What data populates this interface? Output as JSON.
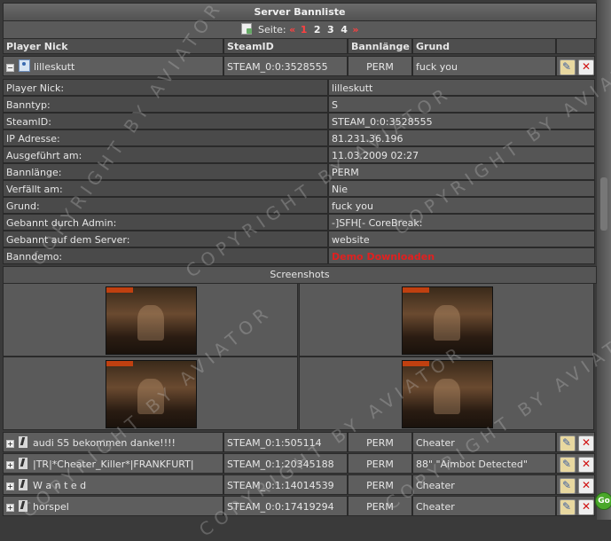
{
  "title": "Server Bannliste",
  "pager": {
    "label": "Seite:",
    "prev": "«",
    "pages": [
      "1",
      "2",
      "3",
      "4"
    ],
    "current": "1",
    "next": "»"
  },
  "columns": {
    "nick": "Player Nick",
    "steam": "SteamID",
    "length": "Bannlänge",
    "reason": "Grund"
  },
  "expanded_row": {
    "toggle": "−",
    "nick": "lilleskutt",
    "steam": "STEAM_0:0:3528555",
    "length": "PERM",
    "reason": "fuck you"
  },
  "details": [
    {
      "label": "Player Nick:",
      "value": "lilleskutt"
    },
    {
      "label": "Banntyp:",
      "value": "S"
    },
    {
      "label": "SteamID:",
      "value": "STEAM_0:0:3528555"
    },
    {
      "label": "IP Adresse:",
      "value": "81.231.36.196"
    },
    {
      "label": "Ausgeführt am:",
      "value": "11.03.2009 02:27"
    },
    {
      "label": "Bannlänge:",
      "value": "PERM"
    },
    {
      "label": "Verfällt am:",
      "value": "Nie"
    },
    {
      "label": "Grund:",
      "value": "fuck you"
    },
    {
      "label": "Gebannt durch Admin:",
      "value": "-]SFH[- CoreBreak:"
    },
    {
      "label": "Gebannt auf dem Server:",
      "value": "website"
    },
    {
      "label": "Banndemo:",
      "value": "Demo Downloaden"
    }
  ],
  "screenshots": {
    "title": "Screenshots"
  },
  "rows": [
    {
      "toggle": "+",
      "nick": "audi S5 bekommen danke!!!!",
      "steam": "STEAM_0:1:505114",
      "length": "PERM",
      "reason": "Cheater"
    },
    {
      "toggle": "+",
      "nick": "|TR|*Cheater_Killer*|FRANKFURT|",
      "steam": "STEAM_0:1:20345188",
      "length": "PERM",
      "reason": "88\" \"Aimbot Detected\""
    },
    {
      "toggle": "+",
      "nick": "W a n t e d",
      "steam": "STEAM_0:1:14014539",
      "length": "PERM",
      "reason": "Cheater"
    },
    {
      "toggle": "+",
      "nick": "horspel",
      "steam": "STEAM_0:0:17419294",
      "length": "PERM",
      "reason": "Cheater"
    }
  ],
  "watermark": "COPYRIGHT BY AVIATOR",
  "badge": "Go",
  "icons": {
    "edit": "edit-icon",
    "delete": "delete-icon",
    "user": "user-icon",
    "player": "counter-strike-icon"
  }
}
